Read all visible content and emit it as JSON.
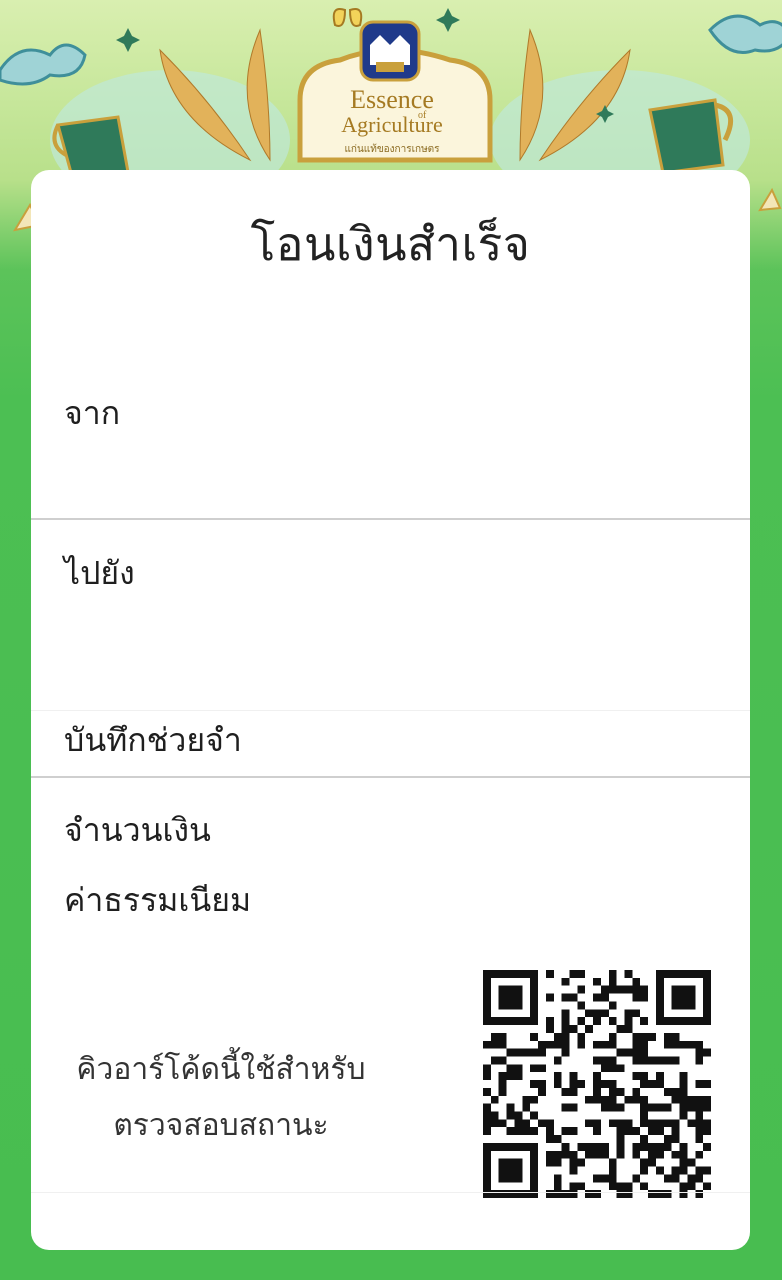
{
  "banner": {
    "logo_line1": "Essence",
    "logo_of": "of",
    "logo_line2": "Agriculture",
    "logo_sub": "แก่นแท้ของการเกษตร"
  },
  "receipt": {
    "title": "โอนเงินสำเร็จ",
    "from_label": "จาก",
    "to_label": "ไปยัง",
    "memo_label": "บันทึกช่วยจำ",
    "amount_label": "จำนวนเงิน",
    "fee_label": "ค่าธรรมเนียม",
    "qr_note_line1": "คิวอาร์โค้ดนี้ใช้สำหรับ",
    "qr_note_line2": "ตรวจสอบสถานะ"
  },
  "colors": {
    "background_green": "#4cbf53",
    "banner_cream": "#d9efb0",
    "gold": "#c9a03c",
    "logo_blue": "#1f3a8a"
  }
}
